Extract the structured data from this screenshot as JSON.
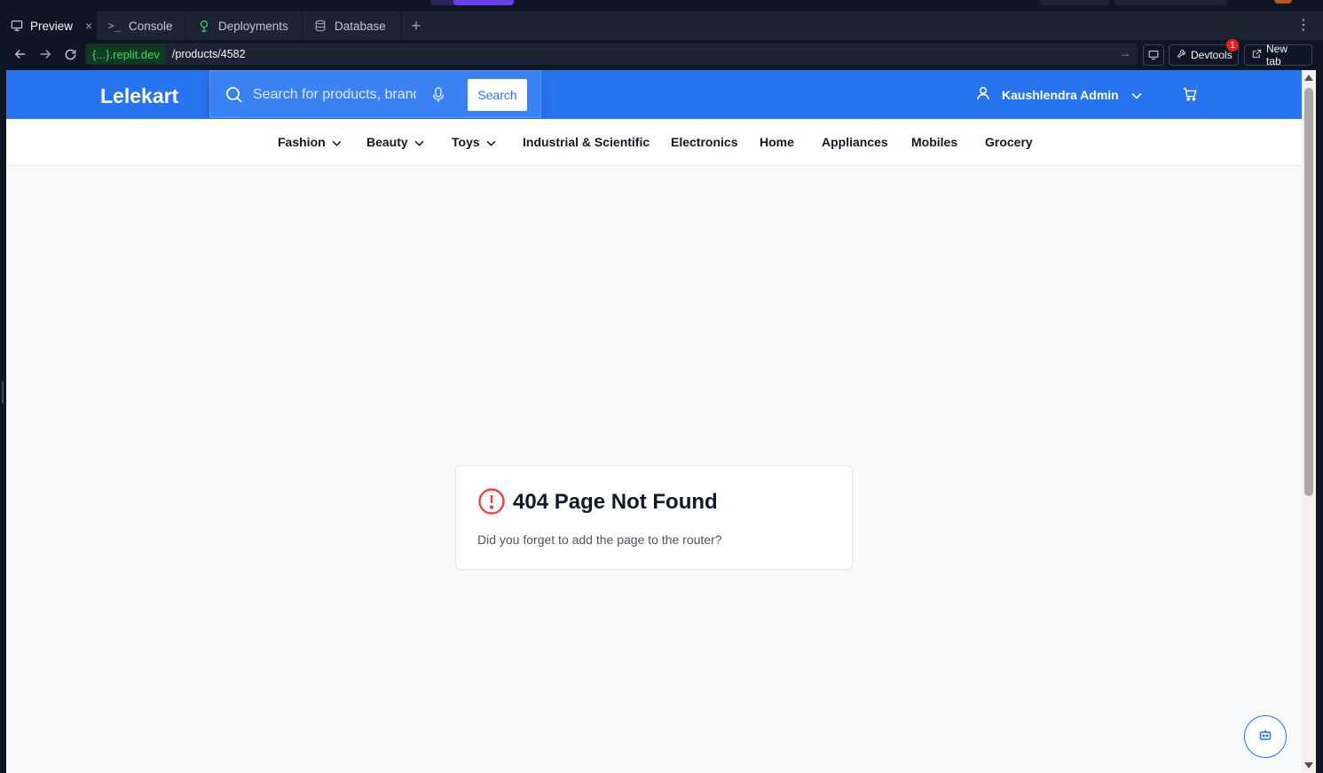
{
  "workspace_tabs": [
    {
      "label": "Preview",
      "icon": "monitor-icon",
      "active": true
    },
    {
      "label": "Console",
      "icon": "terminal-icon",
      "active": false
    },
    {
      "label": "Deployments",
      "icon": "deploy-icon",
      "active": false
    },
    {
      "label": "Database",
      "icon": "database-icon",
      "active": false
    }
  ],
  "address_bar": {
    "domain": "{...}.replit.dev",
    "path": "/products/4582",
    "devtools_label": "Devtools",
    "devtools_badge": "1",
    "new_tab_label": "New tab"
  },
  "site": {
    "logo": "Lelekart",
    "search_placeholder": "Search for products, brands and more",
    "search_button": "Search",
    "user_name": "Kaushlendra Admin",
    "brand_color": "#2874f0"
  },
  "categories": [
    {
      "label": "Fashion",
      "dropdown": true
    },
    {
      "label": "Beauty",
      "dropdown": true
    },
    {
      "label": "Toys",
      "dropdown": true
    },
    {
      "label": "Industrial & Scientific",
      "dropdown": false
    },
    {
      "label": "Electronics",
      "dropdown": false
    },
    {
      "label": "Home",
      "dropdown": false
    },
    {
      "label": "Appliances",
      "dropdown": false
    },
    {
      "label": "Mobiles",
      "dropdown": false
    },
    {
      "label": "Grocery",
      "dropdown": false
    }
  ],
  "error": {
    "title": "404 Page Not Found",
    "message": "Did you forget to add the page to the router?",
    "color": "#ef4444"
  }
}
